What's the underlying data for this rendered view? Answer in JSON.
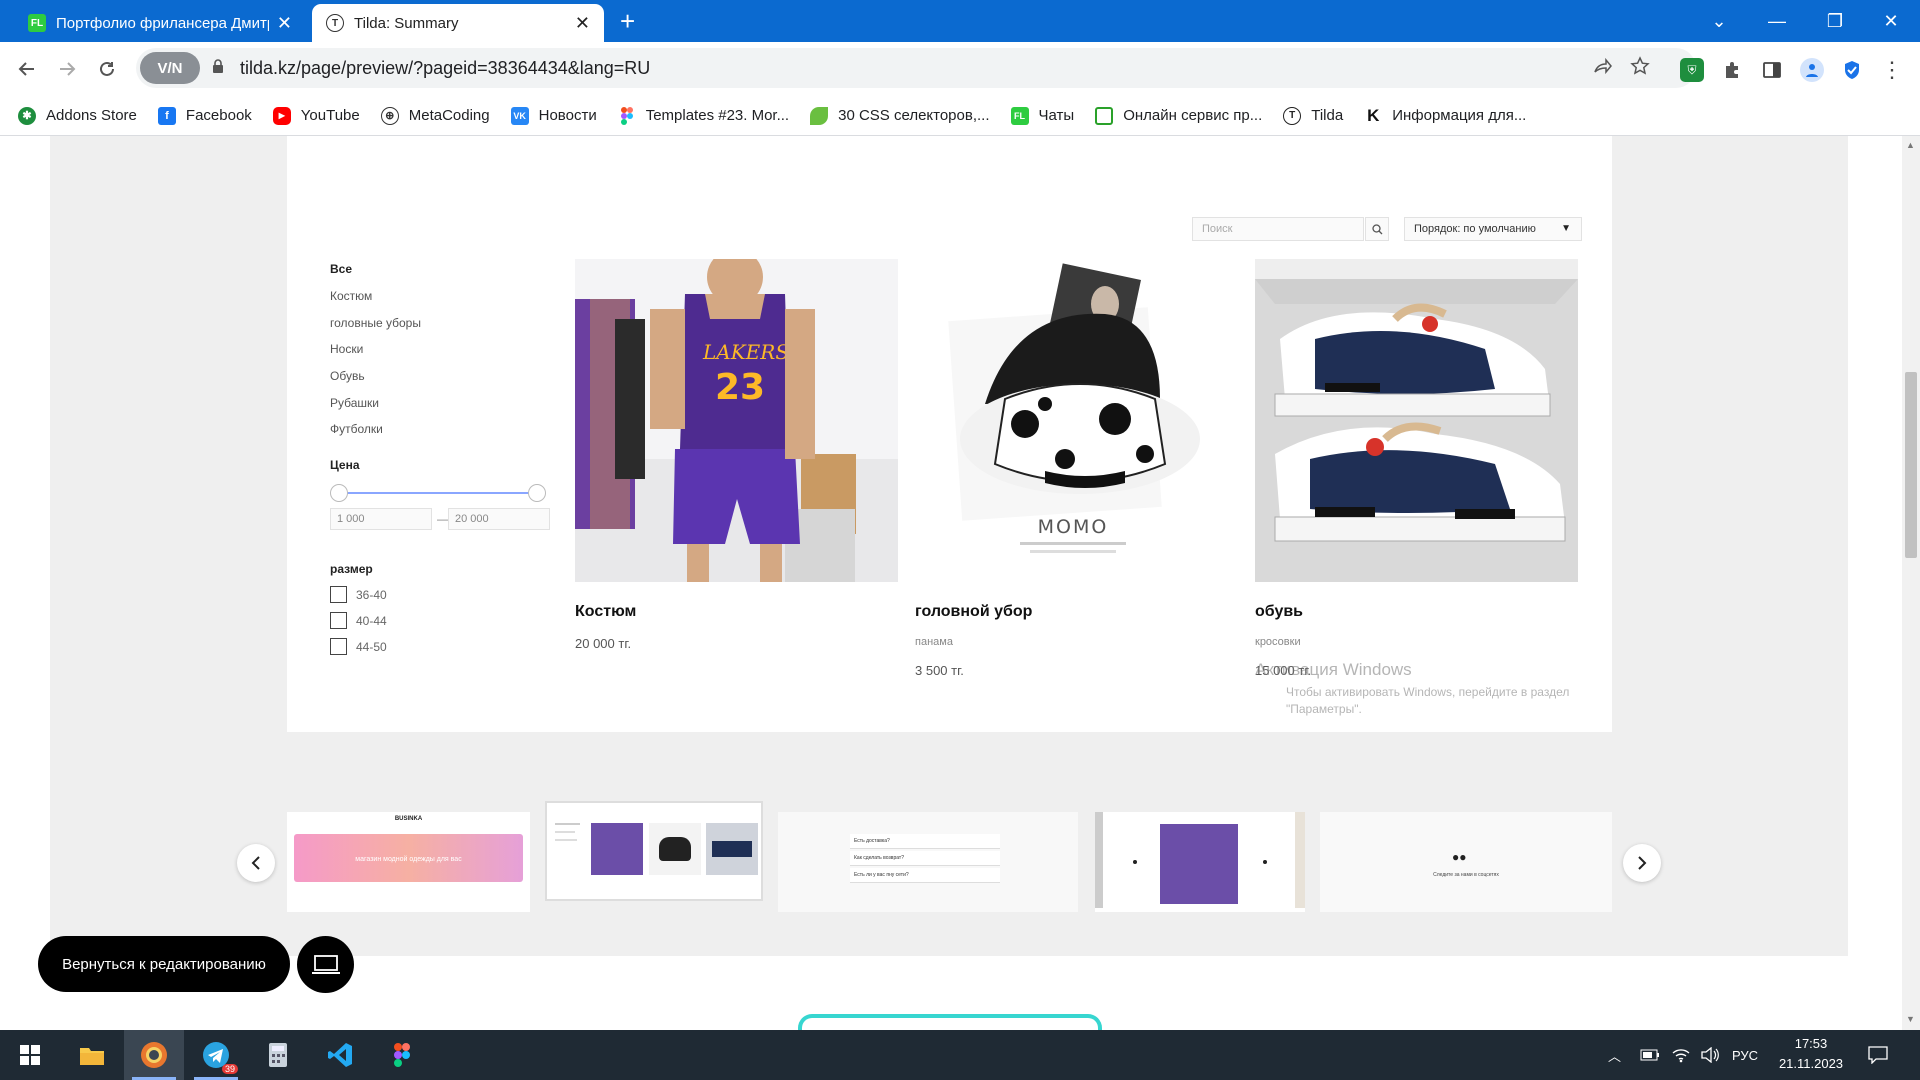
{
  "browser": {
    "tabs": [
      {
        "icon_text": "FL",
        "title": "Портфолио фрилансера Дмитр",
        "close": "✕"
      },
      {
        "icon_text": "T",
        "title": "Tilda: Summary",
        "close": "✕"
      }
    ],
    "new_tab": "+",
    "window_controls": {
      "dropdown": "⌄",
      "minimize": "—",
      "restore": "❐",
      "close": "✕"
    }
  },
  "toolbar": {
    "vpn_label": "V/N",
    "url": "tilda.kz/page/preview/?pageid=38364434&lang=RU"
  },
  "bookmarks": [
    {
      "label": "Addons Store",
      "icon": "addons-icon",
      "color": "#1e8e3e"
    },
    {
      "label": "Facebook",
      "icon": "facebook-icon",
      "color": "#1877f2"
    },
    {
      "label": "YouTube",
      "icon": "youtube-icon",
      "color": "#ff0000"
    },
    {
      "label": "MetaCoding",
      "icon": "metacoding-icon",
      "color": "#333333"
    },
    {
      "label": "Новости",
      "icon": "vk-icon",
      "color": "#2787f5"
    },
    {
      "label": "Templates #23. Mor...",
      "icon": "figma-icon",
      "color": "#f24e1e"
    },
    {
      "label": "30 CSS селекторов,...",
      "icon": "leaf-icon",
      "color": "#6abf40"
    },
    {
      "label": "Чаты",
      "icon": "fl-icon",
      "color": "#2ecc40"
    },
    {
      "label": "Онлайн сервис пр...",
      "icon": "bracket-icon",
      "color": "#2aa12a"
    },
    {
      "label": "Tilda",
      "icon": "tilda-icon",
      "color": "#222222"
    },
    {
      "label": "Информация для...",
      "icon": "k-icon",
      "color": "#111111"
    }
  ],
  "store": {
    "search_placeholder": "Поиск",
    "sort_label": "Порядок: по умолчанию",
    "categories": [
      "Все",
      "Костюм",
      "головные уборы",
      "Носки",
      "Обувь",
      "Рубашки",
      "Футболки"
    ],
    "price_label": "Цена",
    "price_min": "1 000",
    "price_max": "20 000",
    "price_dash": "—",
    "size_label": "размер",
    "sizes": [
      "36-40",
      "40-44",
      "44-50"
    ],
    "products": [
      {
        "title": "Костюм",
        "subtitle": "",
        "price": "20 000 тг."
      },
      {
        "title": "головной убор",
        "subtitle": "панама",
        "price": "3 500 тг."
      },
      {
        "title": "обувь",
        "subtitle": "кросовки",
        "price": "15 000 тг."
      }
    ],
    "momo_text": "MOMO"
  },
  "windows_watermark": {
    "title": "Активация Windows",
    "text": "Чтобы активировать Windows, перейдите в раздел \"Параметры\"."
  },
  "preview_strip": {
    "banner_brand": "BUSINKA",
    "banner_text": "магазин модной одежды для вас",
    "faq": [
      "Есть доставка?",
      "Как сделать возврат?",
      "Есть ли у вас пну сети?"
    ],
    "social_text": "Следите за нами в соцсетях"
  },
  "bottom": {
    "back_label": "Вернуться к редактированию"
  },
  "taskbar": {
    "telegram_badge": "39",
    "lang": "РУС",
    "time": "17:53",
    "date": "21.11.2023"
  }
}
